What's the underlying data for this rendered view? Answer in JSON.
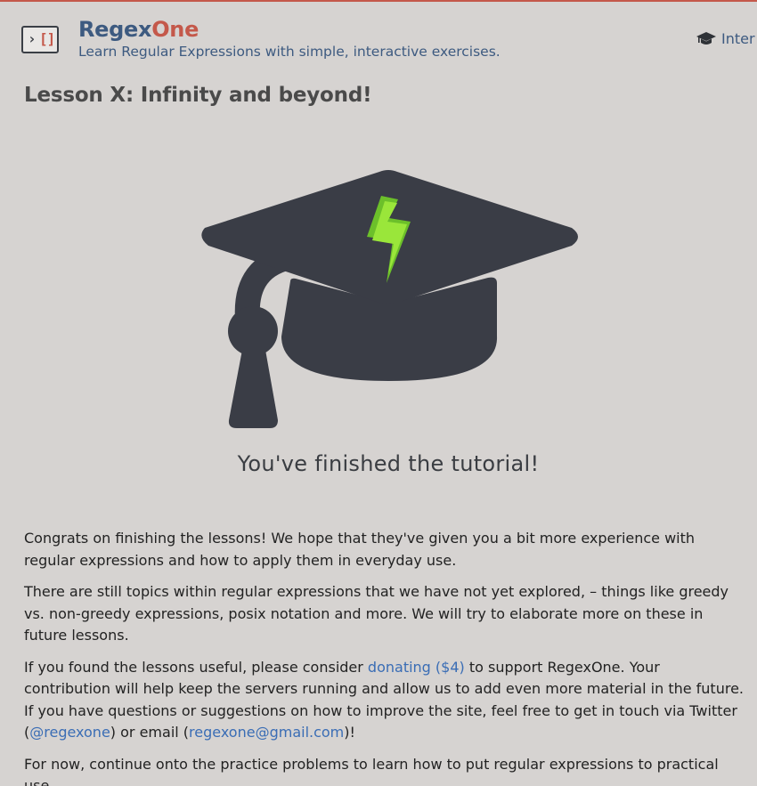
{
  "header": {
    "logo_chevron": "›",
    "logo_brackets": "[]",
    "brand_part1": "Regex",
    "brand_part2": "One",
    "tagline": "Learn Regular Expressions with simple, interactive exercises.",
    "nav_label": "Inter"
  },
  "lesson": {
    "title": "Lesson X: Infinity and beyond!",
    "finished_heading": "You've finished the tutorial!"
  },
  "paragraphs": {
    "p1": "Congrats on finishing the lessons! We hope that they've given you a bit more experience with regular expressions and how to apply them in everyday use.",
    "p2": "There are still topics within regular expressions that we have not yet explored, – things like greedy vs. non-greedy expressions, posix notation and more. We will try to elaborate more on these in future lessons.",
    "p3_a": "If you found the lessons useful, please consider ",
    "p3_link": "donating ($4)",
    "p3_b": " to support RegexOne. Your contribution will help keep the servers running and allow us to add even more material in the future. If you have questions or suggestions on how to improve the site, feel free to get in touch via Twitter (",
    "p3_twitter": "@regexone",
    "p3_c": ") or email (",
    "p3_email": "regexone@gmail.com",
    "p3_d": ")!",
    "p4": "For now, continue onto the practice problems to learn how to put regular expressions to practical use."
  },
  "colors": {
    "background": "#d6d3d1",
    "brand_blue": "#3d5a80",
    "brand_red": "#c4584a",
    "link": "#3a6db5",
    "cap": "#3a3d46",
    "bolt_light": "#9ae63a",
    "bolt_dark": "#6cc02a"
  },
  "icons": {
    "logo": "regexone-logo-icon",
    "nav": "graduation-cap-icon",
    "hero": "graduation-cap-lightning-icon"
  }
}
